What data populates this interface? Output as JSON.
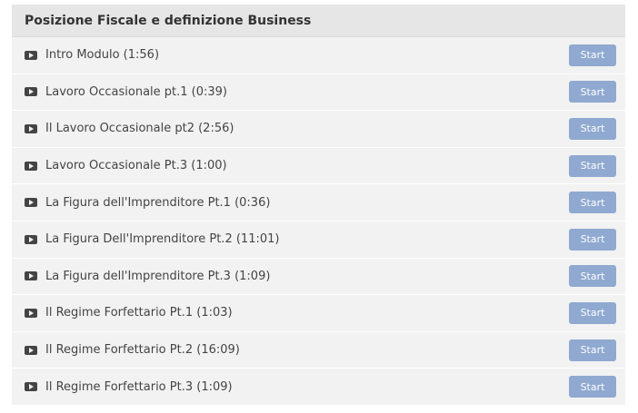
{
  "section": {
    "title": "Posizione Fiscale e definizione Business"
  },
  "lessons": [
    {
      "icon": "play-icon",
      "title": "Intro Modulo (1:56)",
      "button": "Start"
    },
    {
      "icon": "play-icon",
      "title": "Lavoro Occasionale pt.1 (0:39)",
      "button": "Start"
    },
    {
      "icon": "play-icon",
      "title": "Il Lavoro Occasionale pt2 (2:56)",
      "button": "Start"
    },
    {
      "icon": "play-icon",
      "title": "Lavoro Occasionale Pt.3 (1:00)",
      "button": "Start"
    },
    {
      "icon": "play-icon",
      "title": "La Figura dell'Imprenditore Pt.1 (0:36)",
      "button": "Start"
    },
    {
      "icon": "play-icon",
      "title": "La Figura Dell'Imprenditore Pt.2 (11:01)",
      "button": "Start"
    },
    {
      "icon": "play-icon",
      "title": "La Figura dell'Imprenditore Pt.3 (1:09)",
      "button": "Start"
    },
    {
      "icon": "play-icon",
      "title": "Il Regime Forfettario Pt.1 (1:03)",
      "button": "Start"
    },
    {
      "icon": "play-icon",
      "title": "Il Regime Forfettario Pt.2 (16:09)",
      "button": "Start"
    },
    {
      "icon": "play-icon",
      "title": "Il Regime Forfettario Pt.3 (1:09)",
      "button": "Start"
    }
  ],
  "colors": {
    "header_bg": "#e6e6e6",
    "row_bg": "#f2f2f2",
    "button_bg": "#8fa9d0"
  }
}
